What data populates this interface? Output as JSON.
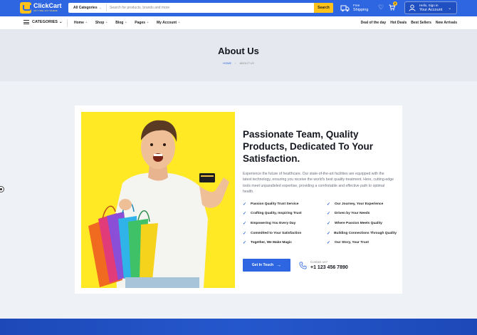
{
  "brand": {
    "name": "ClickCart",
    "tagline": "ANY TIME, ANY WHERE"
  },
  "search": {
    "category": "All Categories",
    "placeholder": "Search for products, brands and more",
    "button": "Search"
  },
  "shipping": {
    "line1": "Free",
    "line2": "Shipping"
  },
  "cart": {
    "count": "2"
  },
  "account": {
    "line1": "Hello, Sign in",
    "line2": "Your Account"
  },
  "nav": {
    "categories_label": "CATEGORIES",
    "menu": [
      "Home",
      "Shop",
      "Blog",
      "Pages",
      "My Account"
    ],
    "quick_links": [
      "Deal of the day",
      "Hot Deals",
      "Best Sellers",
      "New Arrivals"
    ]
  },
  "hero": {
    "title": "About Us",
    "breadcrumb_home": "HOME",
    "breadcrumb_current": "ABOUT US"
  },
  "about": {
    "headline": "Passionate Team, Quality Products, Dedicated To Your Satisfaction.",
    "paragraph": "Experience the future of healthcare. Our state-of-the-art facilities are equipped with the latest technology, ensuring you receive the world's best quality treatment. Here, cutting-edge tools meet unparalleled expertise, providing a comfortable and effective path to optimal health.",
    "features": [
      "Passion Quality Trust Service",
      "Our Journey, Your Experience",
      "Crafting Quality, Inspiring Trust",
      "Driven by Your Needs",
      "Empowering You Every Day",
      "Where Passion Meets Quality",
      "Committed to Your Satisfaction",
      "Building Connections Through Quality",
      "Together, We Make Magic",
      "Our Story, Your Trust"
    ],
    "cta_label": "Get In Touch",
    "contact_label": "Contact us?",
    "phone": "+1 123 456 7890"
  },
  "colors": {
    "primary": "#2d66e0",
    "accent": "#ffc21a",
    "photo_bg": "#ffe924"
  }
}
